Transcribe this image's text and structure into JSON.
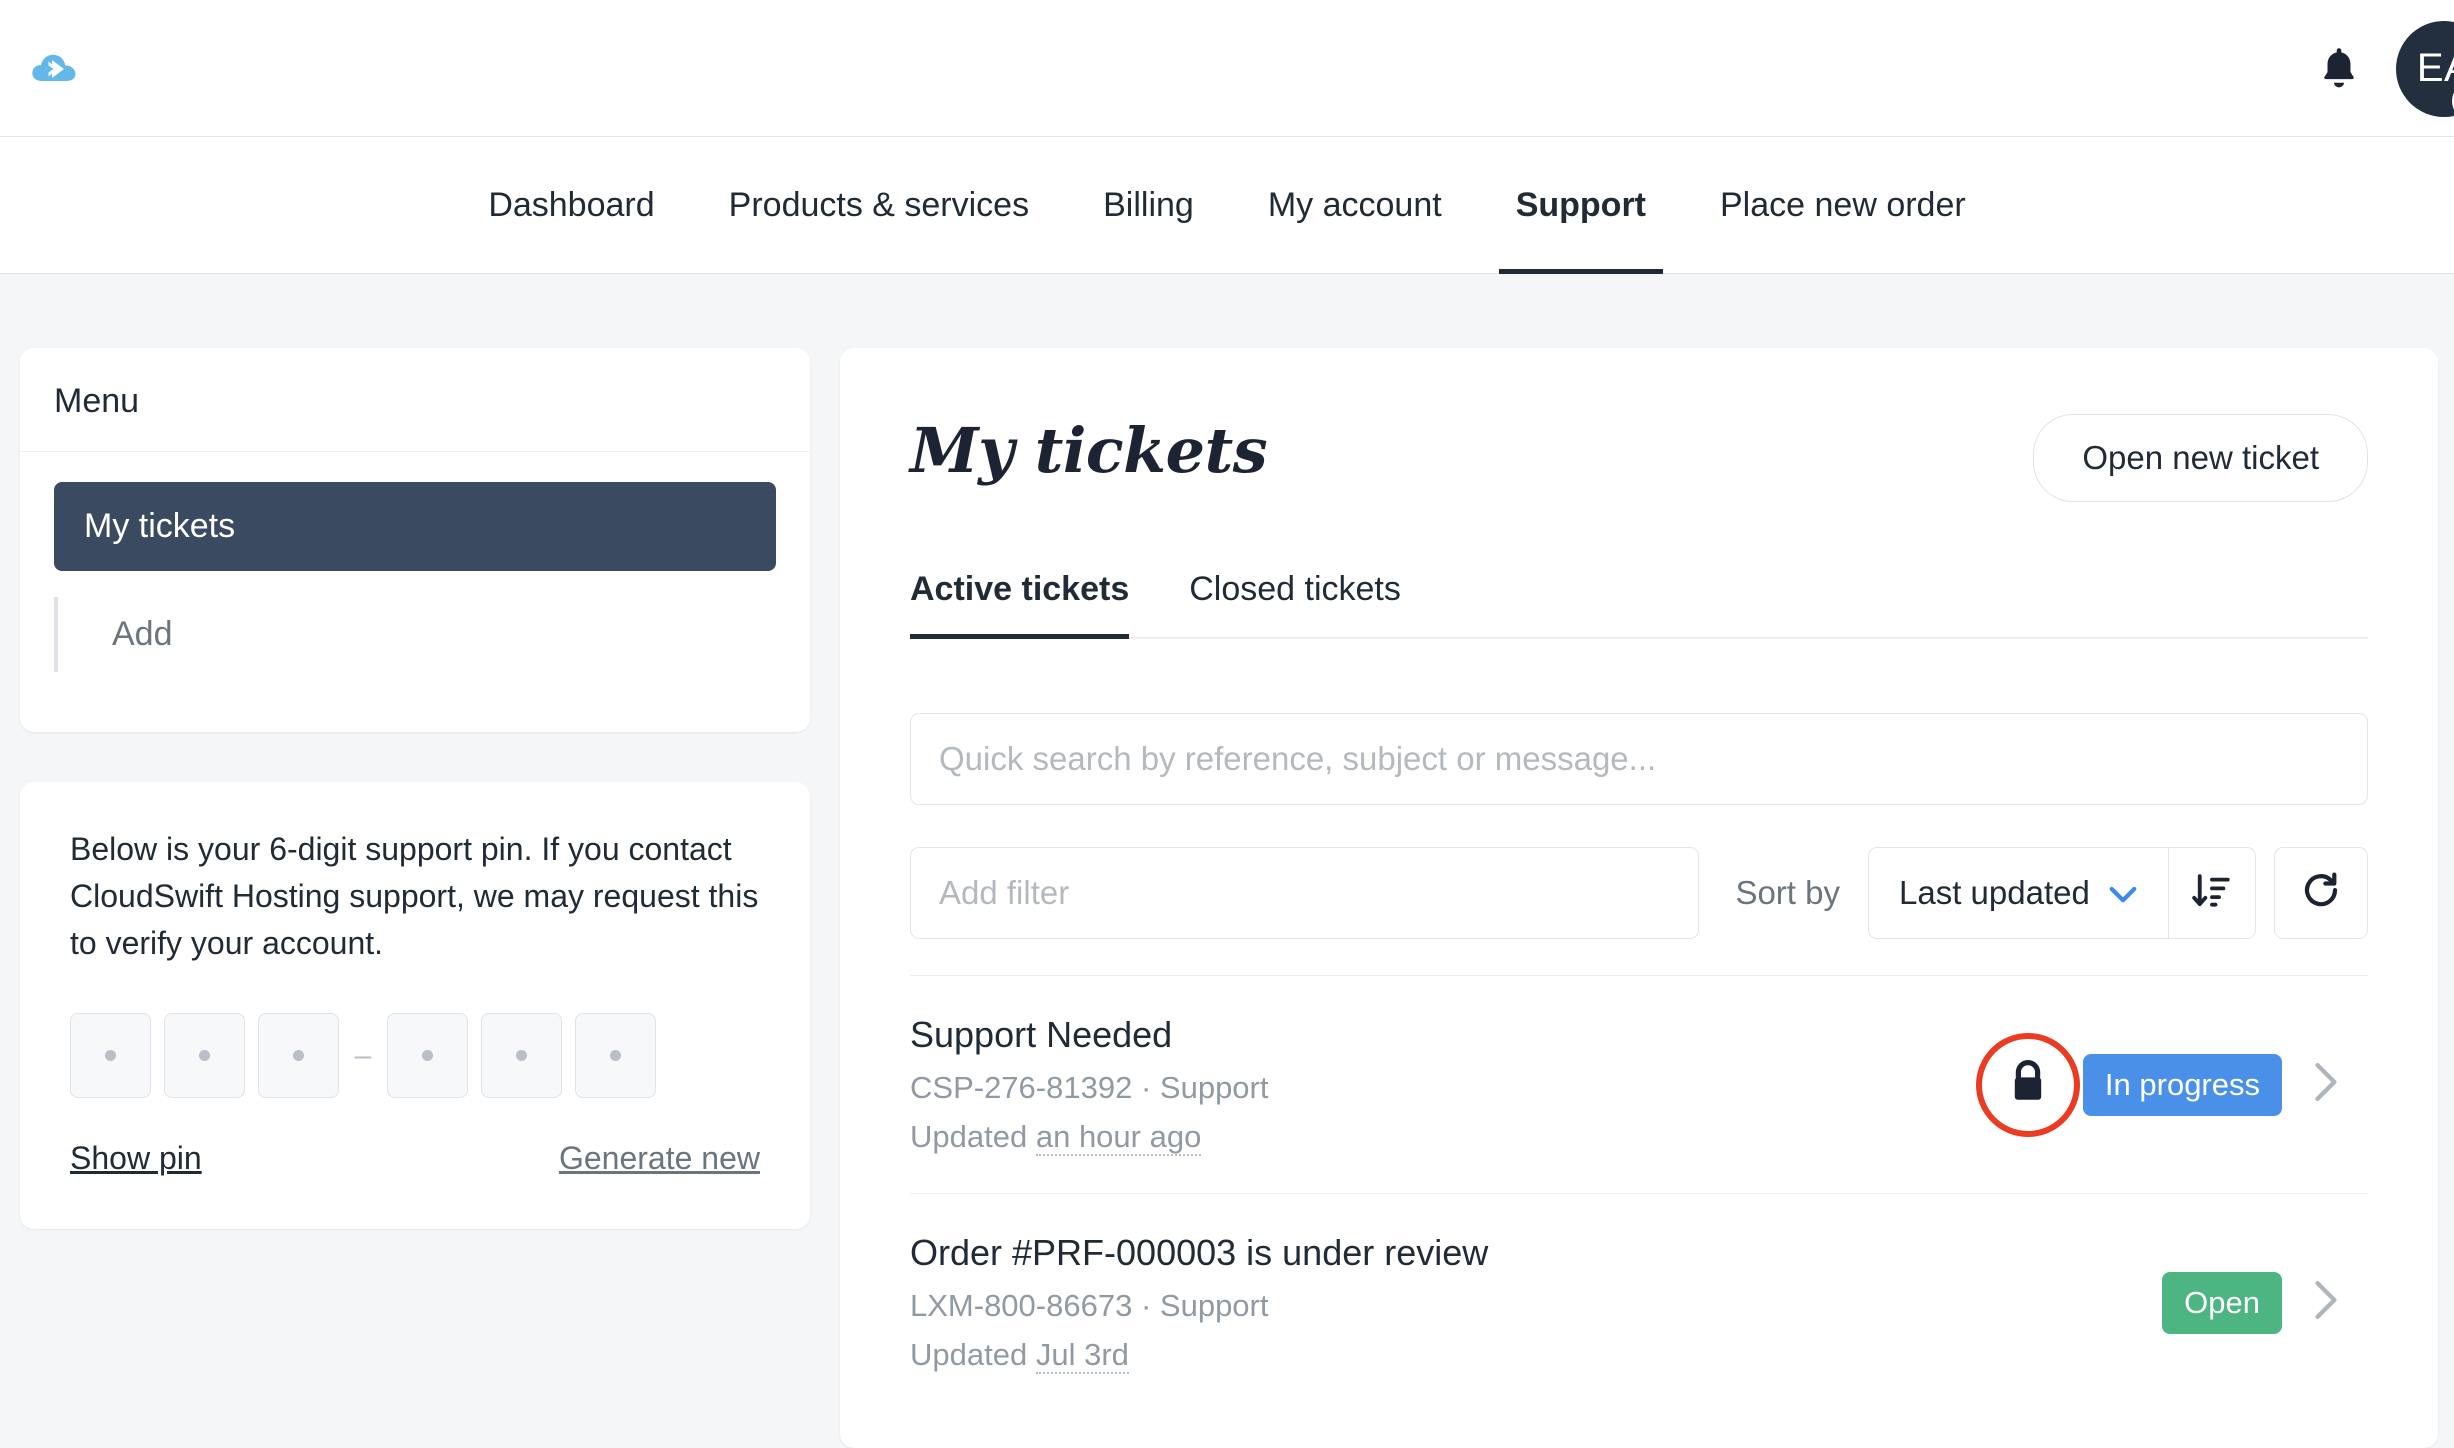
{
  "brand": {
    "logo_icon": "cloud-arrow-logo",
    "logo_color": "#63B8E8"
  },
  "topbar": {
    "notifications_icon": "bell-icon",
    "avatar_initials": "EA",
    "avatar_menu_icon": "chevron-down-icon",
    "avatar_bg": "#232F3E"
  },
  "nav": {
    "items": [
      {
        "label": "Dashboard",
        "active": false
      },
      {
        "label": "Products & services",
        "active": false
      },
      {
        "label": "Billing",
        "active": false
      },
      {
        "label": "My account",
        "active": false
      },
      {
        "label": "Support",
        "active": true
      },
      {
        "label": "Place new order",
        "active": false
      }
    ]
  },
  "sidebar": {
    "title": "Menu",
    "active_item": "My tickets",
    "sub_items": [
      {
        "label": "Add"
      }
    ]
  },
  "pin_card": {
    "description": "Below is your 6-digit support pin. If you contact CloudSwift Hosting support, we may request this to verify your account.",
    "digits_masked": [
      "•",
      "•",
      "•",
      "•",
      "•",
      "•"
    ],
    "separator": "–",
    "show_link": "Show pin",
    "generate_link": "Generate new"
  },
  "main": {
    "title": "My tickets",
    "open_new_ticket_label": "Open new ticket",
    "tabs": [
      {
        "label": "Active tickets",
        "active": true
      },
      {
        "label": "Closed tickets",
        "active": false
      }
    ],
    "search_placeholder": "Quick search by reference, subject or message...",
    "search_value": "",
    "filter_placeholder": "Add filter",
    "filter_value": "",
    "sort_by_label": "Sort by",
    "sort_selected": "Last updated",
    "sort_direction_icon": "sort-descending-icon",
    "refresh_icon": "refresh-icon",
    "chevron_icon": "chevron-right-icon",
    "tickets": [
      {
        "subject": "Support Needed",
        "reference": "CSP-276-81392",
        "department": "Support",
        "updated_prefix": "Updated",
        "updated_value": "an hour ago",
        "status": "In progress",
        "status_color": "#4A90E8",
        "locked": true,
        "lock_icon": "lock-icon",
        "annotated": true,
        "annotation_color": "#EA3B23"
      },
      {
        "subject": "Order #PRF-000003 is under review",
        "reference": "LXM-800-86673",
        "department": "Support",
        "updated_prefix": "Updated",
        "updated_value": "Jul 3rd",
        "status": "Open",
        "status_color": "#4CB581",
        "locked": false,
        "annotated": false
      }
    ],
    "meta_separator": "·"
  }
}
